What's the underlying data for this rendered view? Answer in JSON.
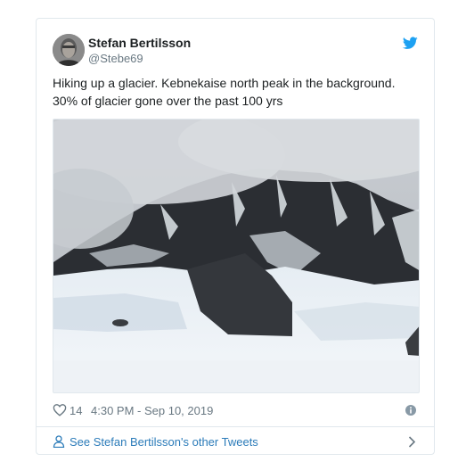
{
  "tweet": {
    "author": {
      "display_name": "Stefan Bertilsson",
      "handle": "@Stebe69"
    },
    "text_line1": "Hiking up a glacier. Kebnekaise north peak in the background.",
    "text_line2": "30% of glacier gone over the past 100 yrs",
    "likes": "14",
    "timestamp": "4:30 PM - Sep 10, 2019",
    "footer_link": "See Stefan Bertilsson's other Tweets"
  },
  "icons": {
    "brand": "twitter-bird-icon",
    "like": "heart-icon",
    "info": "info-icon",
    "profile": "person-icon",
    "more": "chevron-right-icon"
  },
  "colors": {
    "twitter_blue": "#1da1f2",
    "link_blue": "#2b7bb9",
    "meta_gray": "#697882",
    "border": "#e1e8ed"
  }
}
